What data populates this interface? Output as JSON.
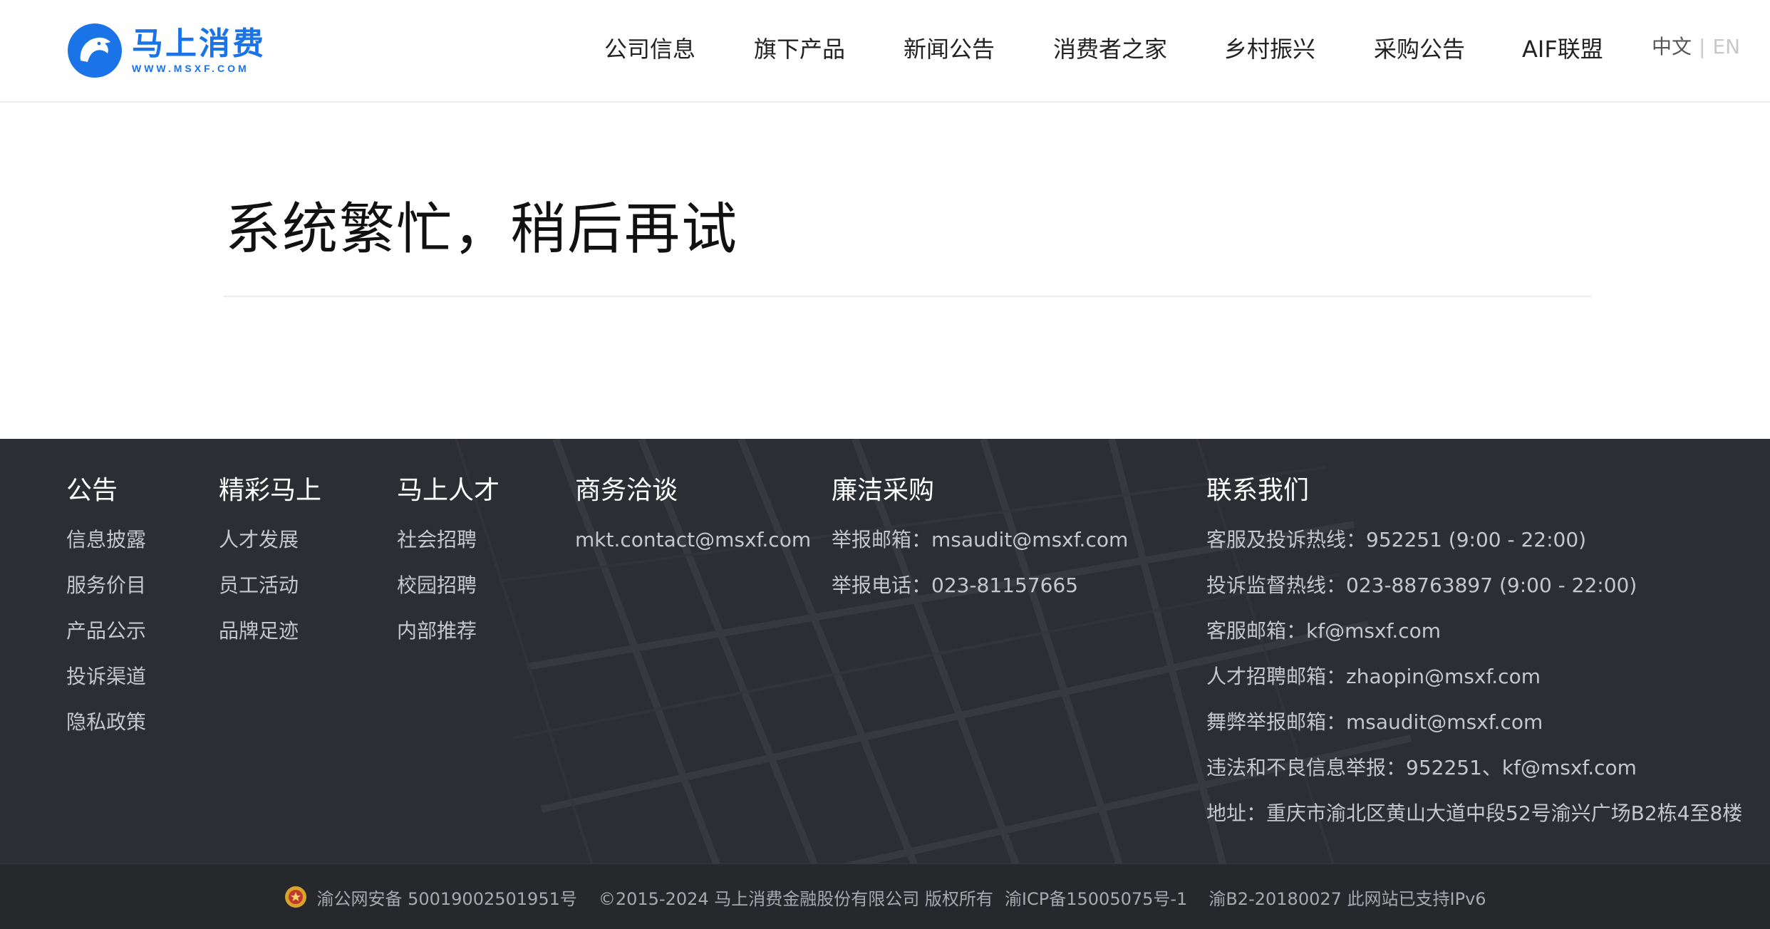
{
  "header": {
    "logo": {
      "cn": "马上消费",
      "en": "WWW.MSXF.COM"
    },
    "nav": [
      {
        "label": "公司信息"
      },
      {
        "label": "旗下产品"
      },
      {
        "label": "新闻公告"
      },
      {
        "label": "消费者之家"
      },
      {
        "label": "乡村振兴"
      },
      {
        "label": "采购公告"
      },
      {
        "label": "AIF联盟"
      }
    ],
    "lang": {
      "cn": "中文",
      "sep": "|",
      "en": "EN"
    }
  },
  "main": {
    "title": "系统繁忙，稍后再试"
  },
  "footer": {
    "columns": {
      "notice": {
        "title": "公告",
        "links": [
          "信息披露",
          "服务价目",
          "产品公示",
          "投诉渠道",
          "隐私政策"
        ]
      },
      "wonderful": {
        "title": "精彩马上",
        "links": [
          "人才发展",
          "员工活动",
          "品牌足迹"
        ]
      },
      "talent": {
        "title": "马上人才",
        "links": [
          "社会招聘",
          "校园招聘",
          "内部推荐"
        ]
      },
      "business": {
        "title": "商务洽谈",
        "links": [
          "mkt.contact@msxf.com"
        ]
      },
      "integrity": {
        "title": "廉洁采购",
        "lines": [
          "举报邮箱：msaudit@msxf.com",
          "举报电话：023-81157665"
        ]
      },
      "contact": {
        "title": "联系我们",
        "lines": [
          "客服及投诉热线：952251 (9:00 - 22:00)",
          "投诉监督热线：023-88763897 (9:00 - 22:00)",
          "客服邮箱：kf@msxf.com",
          "人才招聘邮箱：zhaopin@msxf.com",
          "舞弊举报邮箱：msaudit@msxf.com",
          "违法和不良信息举报：952251、kf@msxf.com",
          "地址：重庆市渝北区黄山大道中段52号渝兴广场B2栋4至8楼"
        ]
      }
    },
    "bottom": {
      "police": "渝公网安备 50019002501951号",
      "copyright": "©2015-2024 马上消费金融股份有限公司 版权所有",
      "icp": "渝ICP备15005075号-1",
      "license": "渝B2-20180027 此网站已支持IPv6"
    }
  },
  "colors": {
    "brand": "#1a74e8",
    "footer_bg": "#2d2e33",
    "footer_text": "#c5c7cc"
  },
  "icons": {
    "logo": "horse-head-logo-icon",
    "police": "police-badge-icon"
  }
}
